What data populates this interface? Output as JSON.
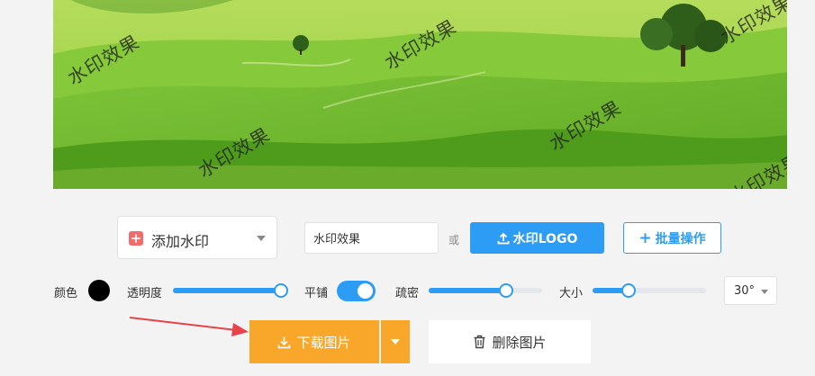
{
  "preview": {
    "watermark_text": "水印效果",
    "watermark_color": "#1e1e1e"
  },
  "toolbar": {
    "add_watermark_label": "添加水印",
    "text_input_value": "水印效果",
    "text_input_placeholder": "",
    "or_label": "或",
    "logo_button_label": "水印LOGO",
    "batch_button_label": "批量操作"
  },
  "settings": {
    "color_label": "颜色",
    "color_value": "#000000",
    "opacity_label": "透明度",
    "opacity_value": 0.95,
    "tile_label": "平铺",
    "tile_on": true,
    "density_label": "疏密",
    "density_value": 0.68,
    "size_label": "大小",
    "size_value": 0.32,
    "angle_value": "30°"
  },
  "actions": {
    "download_label": "下载图片",
    "delete_label": "删除图片"
  },
  "colors": {
    "accent": "#2d9cf4",
    "download": "#f9a72b",
    "add_icon": "#f26a6a",
    "arrow": "#e8424a"
  }
}
